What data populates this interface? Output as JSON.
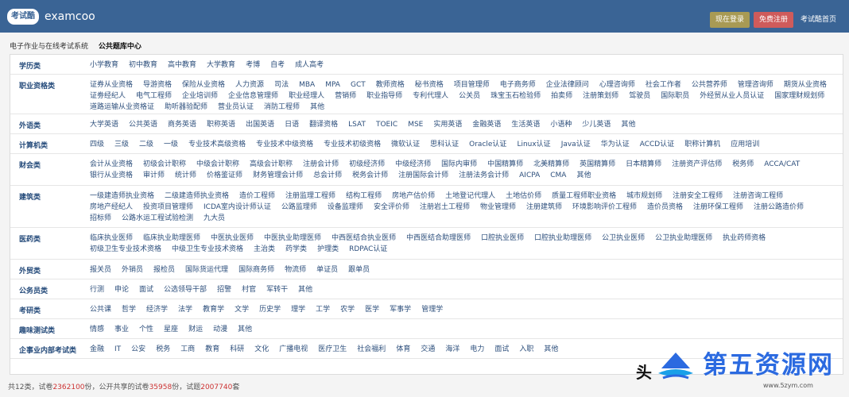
{
  "header": {
    "logo_text": "考试酷",
    "brand": "examcoo",
    "login": "现在登录",
    "register": "免费注册",
    "home": "考试酷首页"
  },
  "breadcrumb": [
    "电子作业与在线考试系统",
    "公共题库中心"
  ],
  "rows": [
    {
      "label": "学历类",
      "items": [
        "小学教育",
        "初中教育",
        "高中教育",
        "大学教育",
        "考博",
        "自考",
        "成人高考"
      ]
    },
    {
      "label": "职业资格类",
      "items": [
        "证券从业资格",
        "导游资格",
        "保险从业资格",
        "人力资源",
        "司法",
        "MBA",
        "MPA",
        "GCT",
        "教师资格",
        "秘书资格",
        "项目管理师",
        "电子商务师",
        "企业法律顾问",
        "心理咨询师",
        "社会工作者",
        "公共营养师",
        "管理咨询师",
        "期货从业资格",
        "证劵经纪人",
        "电气工程师",
        "企业培训师",
        "企业信息管理师",
        "职业经理人",
        "营销师",
        "职业指导师",
        "专利代理人",
        "公关员",
        "珠宝玉石检验师",
        "拍卖师",
        "注册策划师",
        "驾驶员",
        "国际职员",
        "外经贸从业人员认证",
        "国家理财规划师",
        "道路运输从业资格证",
        "助听器验配师",
        "营业员认证",
        "消防工程师",
        "其他"
      ]
    },
    {
      "label": "外语类",
      "items": [
        "大学英语",
        "公共英语",
        "商务英语",
        "职称英语",
        "出国英语",
        "日语",
        "翻译资格",
        "LSAT",
        "TOEIC",
        "MSE",
        "实用英语",
        "金融英语",
        "生活英语",
        "小语种",
        "少儿英语",
        "其他"
      ]
    },
    {
      "label": "计算机类",
      "items": [
        "四级",
        "三级",
        "二级",
        "一级",
        "专业技术高级资格",
        "专业技术中级资格",
        "专业技术初级资格",
        "微软认证",
        "思科认证",
        "Oracle认证",
        "Linux认证",
        "Java认证",
        "华为认证",
        "ACCD认证",
        "职称计算机",
        "应用培训"
      ]
    },
    {
      "label": "财会类",
      "items": [
        "会计从业资格",
        "初级会计职称",
        "中级会计职称",
        "高级会计职称",
        "注册会计师",
        "初级经济师",
        "中级经济师",
        "国际内审师",
        "中国精算师",
        "北美精算师",
        "英国精算师",
        "日本精算师",
        "注册资产评估师",
        "税务师",
        "ACCA/CAT",
        "银行从业资格",
        "审计师",
        "统计师",
        "价格鉴证师",
        "财务管理会计师",
        "总会计师",
        "税务会计师",
        "注册国际会计师",
        "注册法务会计师",
        "AICPA",
        "CMA",
        "其他"
      ]
    },
    {
      "label": "建筑类",
      "items": [
        "一级建造师执业资格",
        "二级建造师执业资格",
        "造价工程师",
        "注册监理工程师",
        "结构工程师",
        "房地产估价师",
        "土地登记代理人",
        "土地估价师",
        "质量工程师职业资格",
        "城市规划师",
        "注册安全工程师",
        "注册咨询工程师",
        "房地产经纪人",
        "投资项目管理师",
        "ICDA室内设计师认证",
        "公路监理师",
        "设备监理师",
        "安全评价师",
        "注册岩土工程师",
        "物业管理师",
        "注册建筑师",
        "环境影响评价工程师",
        "造价员资格",
        "注册环保工程师",
        "注册公路造价师",
        "招标师",
        "公路水运工程试验检测",
        "九大员"
      ]
    },
    {
      "label": "医药类",
      "items": [
        "临床执业医师",
        "临床执业助理医师",
        "中医执业医师",
        "中医执业助理医师",
        "中西医结合执业医师",
        "中西医结合助理医师",
        "口腔执业医师",
        "口腔执业助理医师",
        "公卫执业医师",
        "公卫执业助理医师",
        "执业药师资格",
        "初级卫生专业技术资格",
        "中级卫生专业技术资格",
        "主治类",
        "药学类",
        "护理类",
        "RDPAC认证"
      ]
    },
    {
      "label": "外贸类",
      "items": [
        "报关员",
        "外销员",
        "报检员",
        "国际货运代理",
        "国际商务师",
        "物流师",
        "单证员",
        "跟单员"
      ]
    },
    {
      "label": "公务员类",
      "items": [
        "行测",
        "申论",
        "面试",
        "公选领导干部",
        "招警",
        "村官",
        "军转干",
        "其他"
      ]
    },
    {
      "label": "考研类",
      "items": [
        "公共课",
        "哲学",
        "经济学",
        "法学",
        "教育学",
        "文学",
        "历史学",
        "理学",
        "工学",
        "农学",
        "医学",
        "军事学",
        "管理学"
      ]
    },
    {
      "label": "趣味测试类",
      "items": [
        "情感",
        "事业",
        "个性",
        "星座",
        "财运",
        "动漫",
        "其他"
      ]
    },
    {
      "label": "企事业内部考试类",
      "items": [
        "金融",
        "IT",
        "公安",
        "税务",
        "工商",
        "教育",
        "科研",
        "文化",
        "广播电视",
        "医疗卫生",
        "社会福利",
        "体育",
        "交通",
        "海洋",
        "电力",
        "面试",
        "入职",
        "其他"
      ]
    }
  ],
  "footer": {
    "prefix": "共12类，试卷",
    "papers": "2362100",
    "mid1": "份，公开共享的试卷",
    "shared": "35958",
    "mid2": "份，试题",
    "questions": "2007740",
    "suffix": "套"
  },
  "watermark": {
    "hint": "头",
    "site_name": "第五资源网",
    "url": "www.5zym.com"
  }
}
